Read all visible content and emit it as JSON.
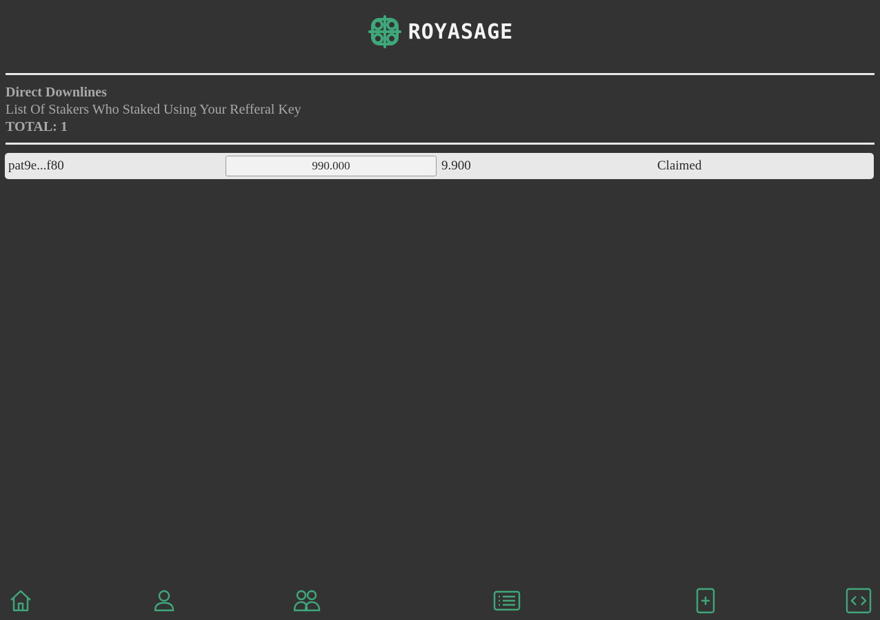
{
  "brand": {
    "name": "ROYASAGE",
    "accent_color": "#3fa87a",
    "logo_icon": "celtic-knot-icon"
  },
  "section": {
    "title": "Direct Downlines",
    "subtitle": "List Of Stakers Who Staked Using Your Refferal Key",
    "total": "TOTAL: 1"
  },
  "downlines": [
    {
      "address": "pat9e...f80",
      "amount": "990.000",
      "reward": "9.900",
      "status": "Claimed"
    }
  ],
  "nav": {
    "items": [
      {
        "icon": "home-icon"
      },
      {
        "icon": "user-icon"
      },
      {
        "icon": "users-icon"
      },
      {
        "icon": "list-icon"
      },
      {
        "icon": "add-document-icon"
      },
      {
        "icon": "code-icon"
      }
    ]
  }
}
